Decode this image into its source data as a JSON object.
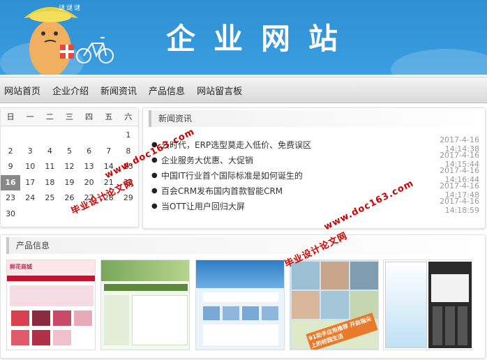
{
  "header": {
    "title": "企业网站",
    "speech": "谜谜谜",
    "colors": {
      "banner": "#3a9ee0"
    }
  },
  "nav": {
    "items": [
      "网站首页",
      "企业介绍",
      "新闻资讯",
      "产品信息",
      "网站留言板"
    ]
  },
  "calendar": {
    "weekdays": [
      "日",
      "一",
      "二",
      "三",
      "四",
      "五",
      "六"
    ],
    "weeks": [
      [
        "",
        "",
        "",
        "",
        "",
        "",
        "1"
      ],
      [
        "2",
        "3",
        "4",
        "5",
        "6",
        "7",
        "8"
      ],
      [
        "9",
        "10",
        "11",
        "12",
        "13",
        "14",
        "15"
      ],
      [
        "16",
        "17",
        "18",
        "19",
        "20",
        "21",
        "22"
      ],
      [
        "23",
        "24",
        "25",
        "26",
        "27",
        "28",
        "29"
      ],
      [
        "30",
        "",
        "",
        "",
        "",
        "",
        ""
      ]
    ],
    "today": "16"
  },
  "news": {
    "title": "新闻资讯",
    "items": [
      {
        "headline": "云时代，ERP选型莫走入低价、免费误区",
        "time": "2017-4-16 14:14:38"
      },
      {
        "headline": "企业服务大优惠、大促销",
        "time": "2017-4-16 14:15:44"
      },
      {
        "headline": "中国IT行业首个国际标准是如何诞生的",
        "time": "2017-4-16 14:16:44"
      },
      {
        "headline": "百会CRM发布国内首款智能CRM",
        "time": "2017-4-16 14:17:48"
      },
      {
        "headline": "当OTT让用户回归大屏",
        "time": "2017-4-16 14:18:59"
      }
    ]
  },
  "products": {
    "title": "产品信息",
    "items": [
      {
        "caption": "鲜花商城"
      },
      {
        "caption": ""
      },
      {
        "caption": ""
      },
      {
        "caption": "91助手应用推荐 开启指尖上的校园生活"
      },
      {
        "caption": ""
      }
    ]
  },
  "watermark": {
    "line1": "毕业设计论文网",
    "line2": "www.doc163.com"
  }
}
